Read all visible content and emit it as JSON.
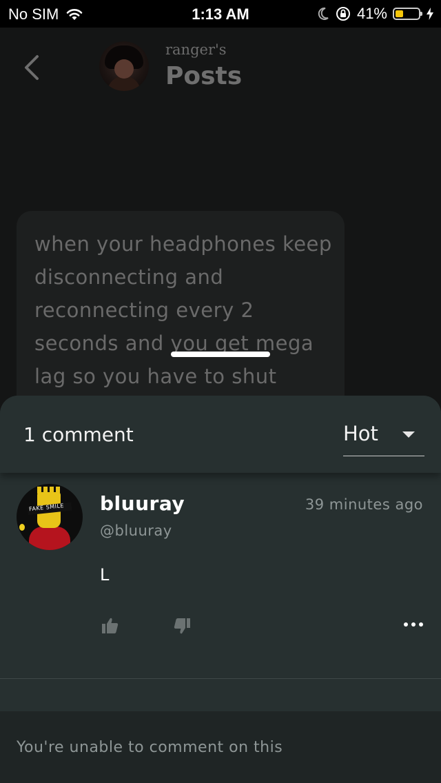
{
  "status_bar": {
    "carrier": "No SIM",
    "time": "1:13 AM",
    "battery_percent": "41%",
    "battery_level": 0.41,
    "battery_color": "#f5c60a"
  },
  "header": {
    "subtitle": "ranger's",
    "title": "Posts",
    "back_icon": "chevron-left-icon"
  },
  "post": {
    "text": "when your headphones keep disconnecting and reconnecting every 2 seconds and you get mega lag so you have to shut"
  },
  "comments_sheet": {
    "count_label": "1 comment",
    "sort": {
      "selected": "Hot"
    },
    "comments": [
      {
        "name": "bluuray",
        "handle": "@bluuray",
        "time": "39 minutes ago",
        "body": "L",
        "avatar_text": "FAKE SMILE"
      }
    ],
    "footer_message": "You're unable to comment on this"
  },
  "colors": {
    "sheet_bg": "#273030",
    "background": "#141515",
    "accent_text": "#ffffff",
    "muted_text": "#8e9696"
  }
}
